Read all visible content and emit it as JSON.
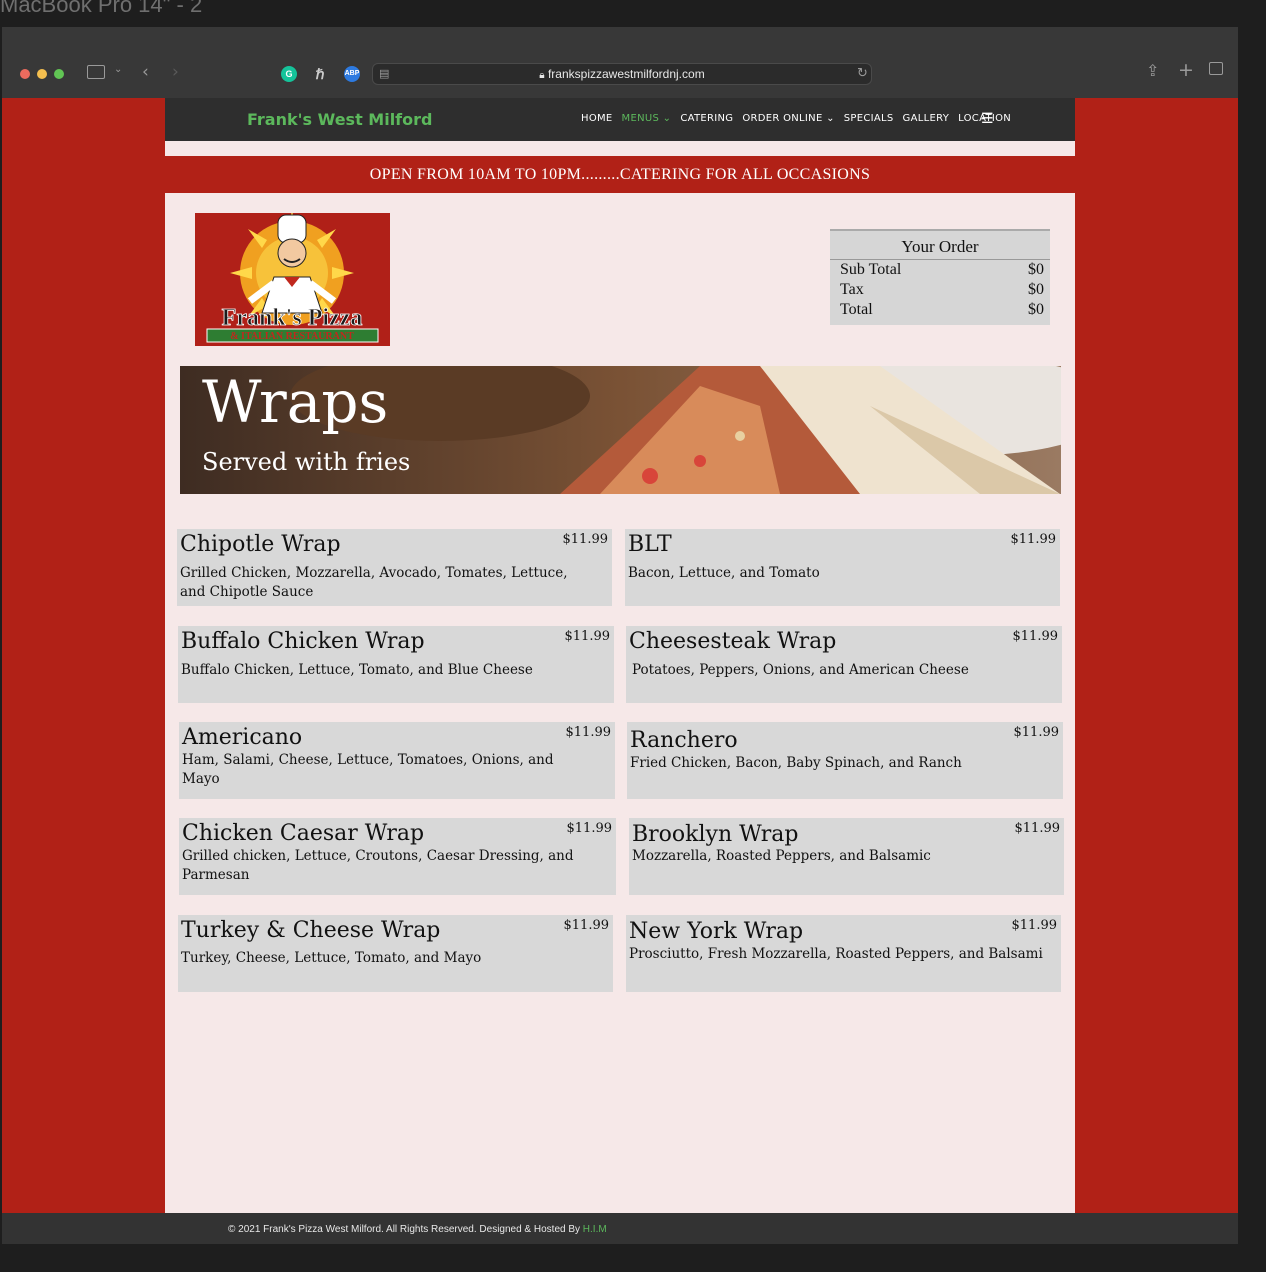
{
  "os": {
    "title": "MacBook Pro 14\" - 2"
  },
  "browser": {
    "url": "frankspizzawestmilfordnj.com",
    "colors": {
      "close": "#ec6b5e",
      "minimize": "#f4bf4f",
      "maximize": "#61c554"
    }
  },
  "site": {
    "brand": "Frank's West Milford",
    "nav": [
      "HOME",
      "MENUS",
      "CATERING",
      "ORDER ONLINE",
      "SPECIALS",
      "GALLERY",
      "LOCATION"
    ],
    "banner": "OPEN FROM 10AM TO 10PM.........CATERING FOR ALL OCCASIONS",
    "logo": {
      "name": "Frank's Pizza",
      "tagline": "& ITALIAN RESTAURANT"
    },
    "order": {
      "title": "Your Order",
      "subtotal_label": "Sub Total",
      "subtotal": "$0",
      "tax_label": "Tax",
      "tax": "$0",
      "total_label": "Total",
      "total": "$0"
    },
    "hero": {
      "title": "Wraps",
      "subtitle": "Served with fries"
    },
    "items": [
      {
        "name": "Chipotle Wrap",
        "price": "$11.99",
        "desc": "Grilled Chicken, Mozzarella, Avocado, Tomates, Lettuce, and Chipotle Sauce"
      },
      {
        "name": "BLT",
        "price": "$11.99",
        "desc": "Bacon, Lettuce, and Tomato"
      },
      {
        "name": "Buffalo Chicken Wrap",
        "price": "$11.99",
        "desc": "Buffalo Chicken, Lettuce, Tomato, and Blue Cheese"
      },
      {
        "name": "Cheesesteak Wrap",
        "price": "$11.99",
        "desc": "Potatoes, Peppers, Onions, and American Cheese"
      },
      {
        "name": "Americano",
        "price": "$11.99",
        "desc": "Ham, Salami, Cheese, Lettuce, Tomatoes, Onions, and Mayo"
      },
      {
        "name": "Ranchero",
        "price": "$11.99",
        "desc": "Fried Chicken, Bacon, Baby Spinach, and Ranch"
      },
      {
        "name": "Chicken Caesar Wrap",
        "price": "$11.99",
        "desc": "Grilled chicken, Lettuce, Croutons, Caesar Dressing, and Parmesan"
      },
      {
        "name": "Brooklyn Wrap",
        "price": "$11.99",
        "desc": "Mozzarella, Roasted Peppers, and Balsamic"
      },
      {
        "name": "Turkey & Cheese Wrap",
        "price": "$11.99",
        "desc": "Turkey, Cheese, Lettuce, Tomato, and Mayo"
      },
      {
        "name": "New York Wrap",
        "price": "$11.99",
        "desc": "Prosciutto, Fresh Mozzarella, Roasted Peppers, and Balsami"
      }
    ],
    "footer": {
      "text": "© 2021 Frank's Pizza West Milford. All Rights Reserved. Designed & Hosted By ",
      "link": "H.I.M"
    }
  }
}
